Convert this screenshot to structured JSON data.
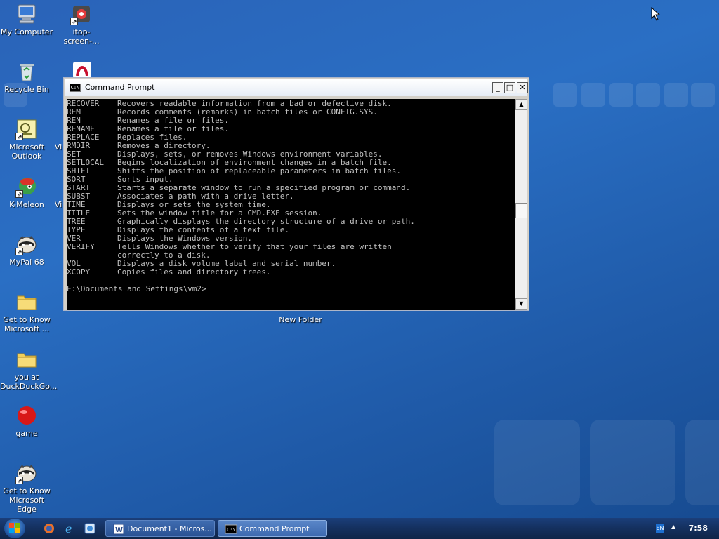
{
  "desktop": {
    "icons": [
      {
        "label": "My Computer"
      },
      {
        "label": "itop-screen-..."
      },
      {
        "label": "Recycle Bin"
      },
      {
        "label": "Microsoft Outlook"
      },
      {
        "label": "K-Meleon"
      },
      {
        "label": "MyPal 68"
      },
      {
        "label": "Get to Know Microsoft ..."
      },
      {
        "label": "you at DuckDuckGo..."
      },
      {
        "label": "game"
      },
      {
        "label": "Get to Know Microsoft Edge"
      },
      {
        "label": "New Folder"
      },
      {
        "label": "Vi"
      },
      {
        "label": "Vi"
      }
    ]
  },
  "window": {
    "title": "Command Prompt",
    "minimize_glyph": "_",
    "maximize_glyph": "□",
    "close_glyph": "✕",
    "lines": [
      {
        "cmd": "RECOVER",
        "desc": "Recovers readable information from a bad or defective disk."
      },
      {
        "cmd": "REM",
        "desc": "Records comments (remarks) in batch files or CONFIG.SYS."
      },
      {
        "cmd": "REN",
        "desc": "Renames a file or files."
      },
      {
        "cmd": "RENAME",
        "desc": "Renames a file or files."
      },
      {
        "cmd": "REPLACE",
        "desc": "Replaces files."
      },
      {
        "cmd": "RMDIR",
        "desc": "Removes a directory."
      },
      {
        "cmd": "SET",
        "desc": "Displays, sets, or removes Windows environment variables."
      },
      {
        "cmd": "SETLOCAL",
        "desc": "Begins localization of environment changes in a batch file."
      },
      {
        "cmd": "SHIFT",
        "desc": "Shifts the position of replaceable parameters in batch files."
      },
      {
        "cmd": "SORT",
        "desc": "Sorts input."
      },
      {
        "cmd": "START",
        "desc": "Starts a separate window to run a specified program or command."
      },
      {
        "cmd": "SUBST",
        "desc": "Associates a path with a drive letter."
      },
      {
        "cmd": "TIME",
        "desc": "Displays or sets the system time."
      },
      {
        "cmd": "TITLE",
        "desc": "Sets the window title for a CMD.EXE session."
      },
      {
        "cmd": "TREE",
        "desc": "Graphically displays the directory structure of a drive or path."
      },
      {
        "cmd": "TYPE",
        "desc": "Displays the contents of a text file."
      },
      {
        "cmd": "VER",
        "desc": "Displays the Windows version."
      },
      {
        "cmd": "VERIFY",
        "desc": "Tells Windows whether to verify that your files are written"
      },
      {
        "cmd": "",
        "desc": "correctly to a disk."
      },
      {
        "cmd": "VOL",
        "desc": "Displays a disk volume label and serial number."
      },
      {
        "cmd": "XCOPY",
        "desc": "Copies files and directory trees."
      }
    ],
    "prompt": "E:\\Documents and Settings\\vm2>",
    "scroll_up_glyph": "▲",
    "scroll_down_glyph": "▼"
  },
  "taskbar": {
    "buttons": [
      {
        "label": "Document1 - Micros...",
        "icon": "word-icon"
      },
      {
        "label": "Command Prompt",
        "icon": "cmd-icon"
      }
    ],
    "language": "EN",
    "tray_arrow": "▲",
    "clock": "7:58"
  }
}
